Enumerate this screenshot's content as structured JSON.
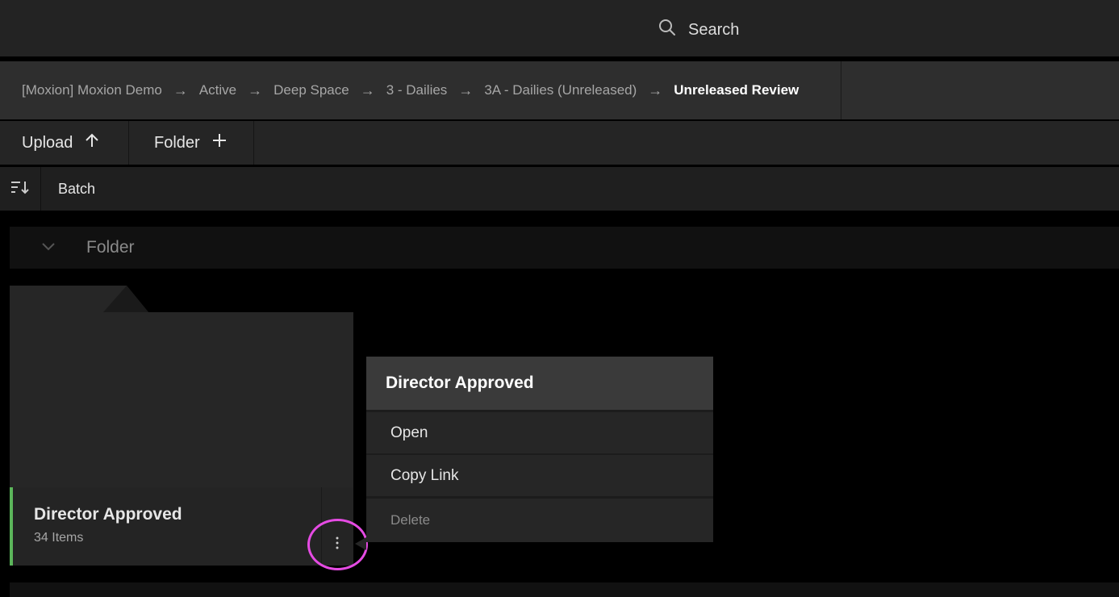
{
  "search": {
    "label": "Search",
    "icon": "search-icon"
  },
  "breadcrumb": {
    "items": [
      "[Moxion] Moxion Demo",
      "Active",
      "Deep Space",
      "3 - Dailies",
      "3A - Dailies (Unreleased)"
    ],
    "current": "Unreleased Review",
    "separator": "→"
  },
  "toolbar": {
    "upload_label": "Upload",
    "upload_icon": "arrow-up-icon",
    "folder_label": "Folder",
    "folder_icon": "plus-icon"
  },
  "subbar": {
    "sort_icon": "sort-icon",
    "batch_label": "Batch"
  },
  "section": {
    "title": "Folder",
    "icon": "chevron-down-icon"
  },
  "folder_card": {
    "name": "Director Approved",
    "count": "34 Items",
    "accent": "#5bb55a",
    "more_icon": "more-vertical-icon"
  },
  "context_menu": {
    "title": "Director Approved",
    "items": [
      {
        "label": "Open",
        "enabled": true
      },
      {
        "label": "Copy Link",
        "enabled": true
      },
      {
        "label": "Delete",
        "enabled": false
      }
    ]
  },
  "highlight_color": "#e54be3"
}
